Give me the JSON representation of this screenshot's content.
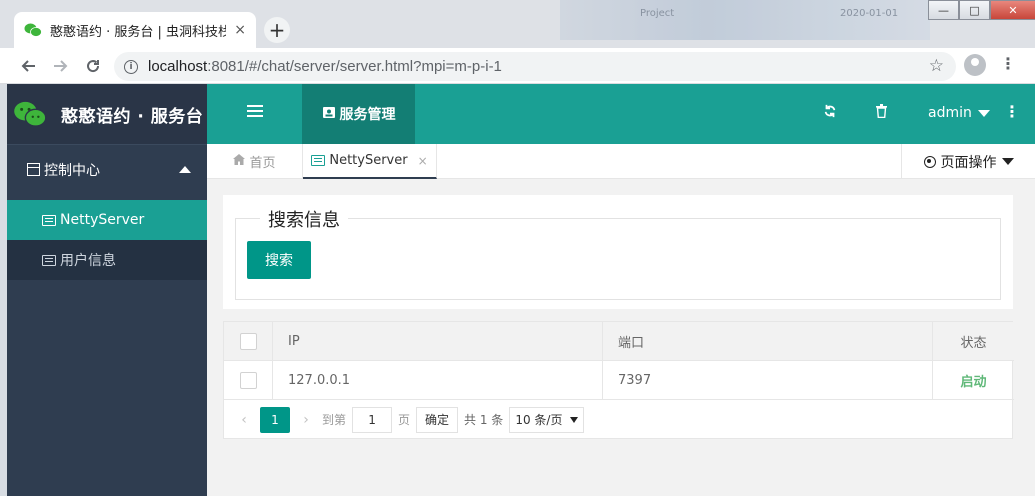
{
  "browser": {
    "tab_title": "憨憨语约 · 服务台 | 虫洞科技栈 h",
    "tab_close": "×",
    "new_tab": "+",
    "url_host": "localhost",
    "url_rest": ":8081/#/chat/server/server.html?mpi=m-p-i-1",
    "bg_text_1": "Project",
    "bg_text_2": "2020-01-01",
    "win_min": "—",
    "win_max": "□",
    "win_close": "✕"
  },
  "app": {
    "logo_text": "憨憨语约 · 服务台",
    "topbar": {
      "active_module": "服务管理",
      "user": "admin"
    },
    "sidebar": {
      "section": "控制中心",
      "items": [
        {
          "label": "NettyServer",
          "active": true
        },
        {
          "label": "用户信息",
          "active": false
        }
      ]
    },
    "page_tabs": {
      "home": "首页",
      "current": "NettyServer",
      "close": "×",
      "page_ops": "页面操作"
    },
    "search": {
      "legend": "搜索信息",
      "button": "搜索"
    },
    "table": {
      "headers": {
        "ip": "IP",
        "port": "端口",
        "status": "状态"
      },
      "rows": [
        {
          "ip": "127.0.0.1",
          "port": "7397",
          "status": "启动"
        }
      ]
    },
    "pager": {
      "prev": "‹",
      "next": "›",
      "current_page": "1",
      "goto_label": "到第",
      "goto_value": "1",
      "page_unit": "页",
      "confirm": "确定",
      "total": "共 1 条",
      "page_size": "10 条/页"
    }
  },
  "colors": {
    "accent": "#1aa094",
    "accent_dark": "#137e74",
    "button": "#009688",
    "sidebar": "#2f3d50",
    "status_ok": "#5fb878"
  }
}
